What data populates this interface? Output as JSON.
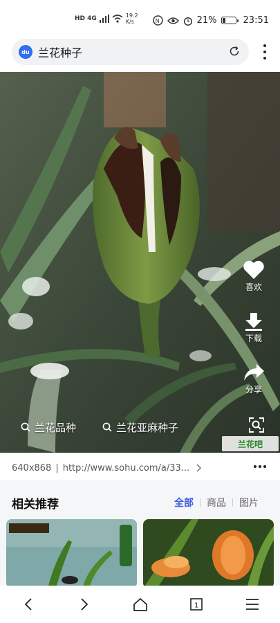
{
  "status": {
    "network": "HD 4G",
    "speed_value": "19.2",
    "speed_unit": "K/s",
    "battery": "21%",
    "time": "23:51"
  },
  "search": {
    "query": "兰花种子"
  },
  "photo": {
    "actions": {
      "like": "喜欢",
      "download": "下载",
      "share": "分享"
    },
    "chips": [
      "兰花品种",
      "兰花亚麻种子"
    ],
    "watermark": "兰花吧"
  },
  "meta": {
    "dimensions": "640x868",
    "url": "http://www.sohu.com/a/33..."
  },
  "recommend": {
    "title": "相关推荐",
    "tabs": [
      "全部",
      "商品",
      "图片"
    ],
    "active_tab": "全部"
  },
  "colors": {
    "accent": "#3d5fe0",
    "baidu": "#2f6ff0"
  }
}
